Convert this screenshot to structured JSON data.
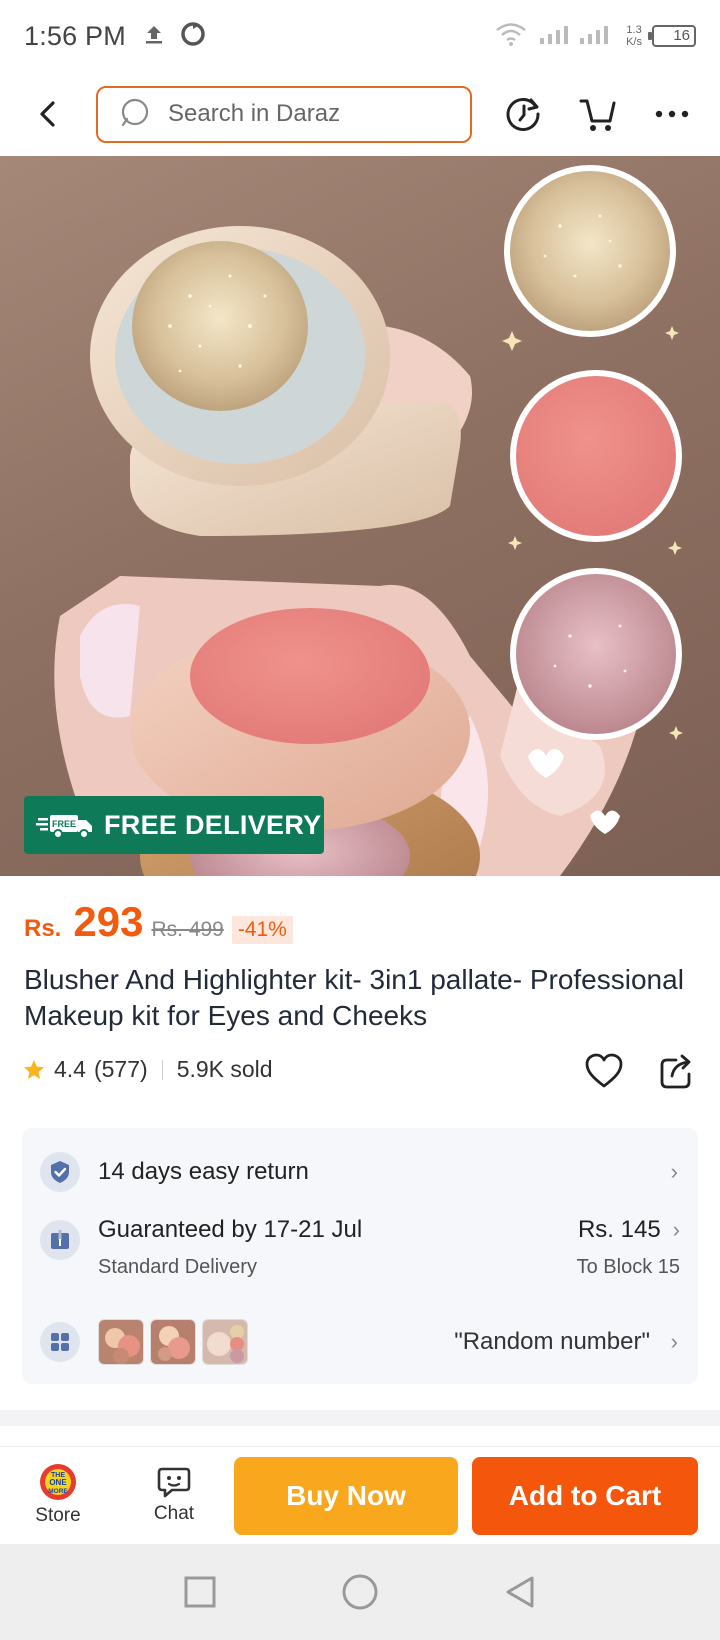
{
  "status_bar": {
    "time": "1:56 PM",
    "net_speed_value": "1.3",
    "net_speed_unit": "K/s",
    "battery": "16"
  },
  "header": {
    "search_placeholder": "Search in Daraz"
  },
  "hero": {
    "badge_tag": "FREE",
    "badge_text": "FREE DELIVERY"
  },
  "price": {
    "currency": "Rs.",
    "current": "293",
    "original": "Rs. 499",
    "discount": "-41%"
  },
  "product": {
    "title": "Blusher And Highlighter kit- 3in1 pallate- Professional Makeup kit for Eyes and Cheeks",
    "rating": "4.4",
    "reviews": "(577)",
    "sold": "5.9K sold"
  },
  "info": {
    "returns": "14 days easy return",
    "delivery_title": "Guaranteed by 17-21 Jul",
    "delivery_type": "Standard Delivery",
    "delivery_price": "Rs. 145",
    "delivery_location": "To Block 15",
    "variant_label": "\"Random number\""
  },
  "bottom_bar": {
    "store_label": "Store",
    "store_logo_text": "THE ONE MORE",
    "chat_label": "Chat",
    "buy_now": "Buy Now",
    "add_to_cart": "Add to Cart"
  },
  "colors": {
    "accent": "#f25b0e",
    "search_border": "#e46a1e",
    "buy_now": "#f9a81d",
    "add_to_cart": "#f4560c",
    "free_delivery": "#0f7a57"
  }
}
